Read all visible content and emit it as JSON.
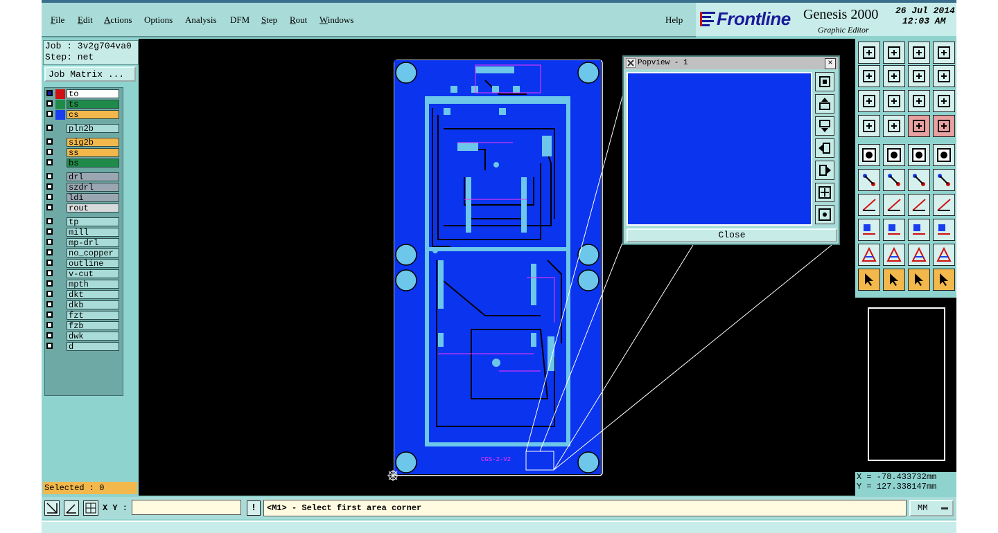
{
  "menubar": {
    "items": [
      {
        "label": "File",
        "ul": "F",
        "rest": "ile"
      },
      {
        "label": "Edit",
        "ul": "E",
        "rest": "dit"
      },
      {
        "label": "Actions",
        "ul": "A",
        "rest": "ctions"
      },
      {
        "label": "Options",
        "ul": "",
        "rest": "Options"
      },
      {
        "label": "Analysis",
        "ul": "",
        "rest": "Analysis"
      },
      {
        "label": "DFM",
        "ul": "",
        "rest": "DFM"
      },
      {
        "label": "Step",
        "ul": "S",
        "rest": "tep"
      },
      {
        "label": "Rout",
        "ul": "R",
        "rest": "out"
      },
      {
        "label": "Windows",
        "ul": "W",
        "rest": "indows"
      }
    ],
    "help": "Help"
  },
  "brand": {
    "name": "Frontline",
    "product": "Genesis 2000",
    "subtitle": "Graphic Editor",
    "date": "26 Jul 2014",
    "time": "12:03 AM"
  },
  "job": {
    "job_line": "Job : 3v2g704va0",
    "step_line": "Step: net",
    "matrix_button": "Job Matrix ..."
  },
  "layers": [
    {
      "name": "to",
      "color": "#ffffff",
      "swatch": "#d01010",
      "check": "#1a1aa0"
    },
    {
      "name": "ts",
      "color": "#1f8a4a",
      "swatch": "#1f8a4a"
    },
    {
      "name": "cs",
      "color": "#f2b84b",
      "swatch": "#1a3df0"
    },
    {
      "name": "pln2b",
      "color": "#a9dcd8",
      "swatch": ""
    },
    {
      "name": "sig2b",
      "color": "#f2b84b",
      "swatch": ""
    },
    {
      "name": "ss",
      "color": "#f2b84b",
      "swatch": ""
    },
    {
      "name": "bs",
      "color": "#1f8a4a",
      "swatch": ""
    },
    {
      "name": "drl",
      "color": "#9aa7b2",
      "swatch": ""
    },
    {
      "name": "szdrl",
      "color": "#9aa7b2",
      "swatch": ""
    },
    {
      "name": "ldi",
      "color": "#9aa7b2",
      "swatch": ""
    },
    {
      "name": "rout",
      "color": "#d7dada",
      "swatch": ""
    },
    {
      "name": "tp",
      "color": "#a9dcd8",
      "swatch": ""
    },
    {
      "name": "mill",
      "color": "#a9dcd8",
      "swatch": ""
    },
    {
      "name": "mp-drl",
      "color": "#a9dcd8",
      "swatch": ""
    },
    {
      "name": "no_copper",
      "color": "#a9dcd8",
      "swatch": ""
    },
    {
      "name": "outline",
      "color": "#a9dcd8",
      "swatch": ""
    },
    {
      "name": "v-cut",
      "color": "#a9dcd8",
      "swatch": ""
    },
    {
      "name": "mpth",
      "color": "#a9dcd8",
      "swatch": ""
    },
    {
      "name": "dkt",
      "color": "#a9dcd8",
      "swatch": ""
    },
    {
      "name": "dkb",
      "color": "#a9dcd8",
      "swatch": ""
    },
    {
      "name": "fzt",
      "color": "#a9dcd8",
      "swatch": ""
    },
    {
      "name": "fzb",
      "color": "#a9dcd8",
      "swatch": ""
    },
    {
      "name": "dwk",
      "color": "#a9dcd8",
      "swatch": ""
    },
    {
      "name": "d",
      "color": "#a9dcd8",
      "swatch": ""
    }
  ],
  "selected": "Selected : 0",
  "board": {
    "label": "CGS-2-V2"
  },
  "popview": {
    "title": "Popview - 1",
    "close": "Close"
  },
  "coords": {
    "x": "X = -78.433732mm",
    "y": "Y = 127.338147mm"
  },
  "status": {
    "xy_label": "X Y :",
    "xy_value": "",
    "prompt": "<M1> - Select first area corner",
    "unit": "MM"
  },
  "colors": {
    "board": "#0b34ee",
    "copper": "#6cc7ea",
    "trace_dark": "#000000",
    "silk": "#ff33ff"
  }
}
